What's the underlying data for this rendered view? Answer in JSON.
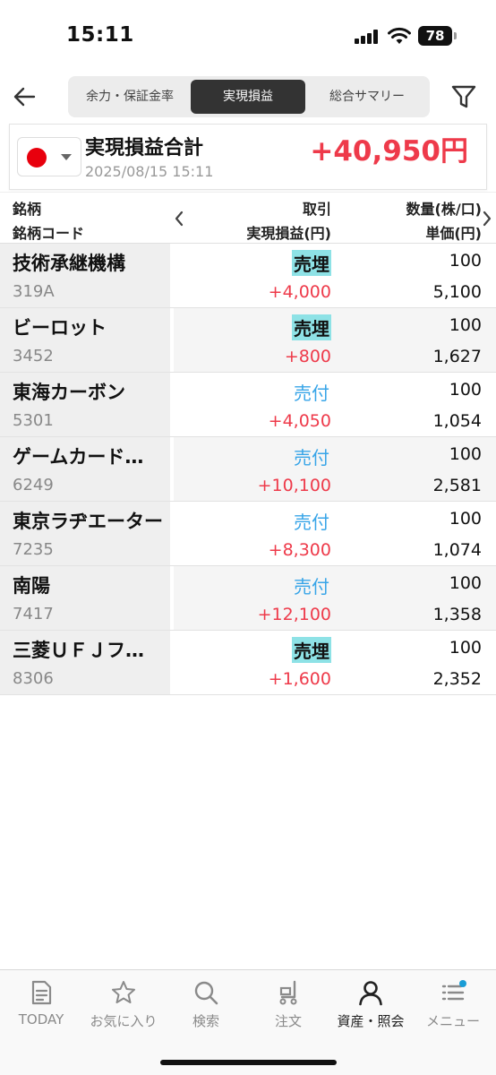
{
  "status": {
    "time": "15:11",
    "battery": "78"
  },
  "header": {
    "tabs": [
      {
        "label": "余力・保証金率",
        "active": false
      },
      {
        "label": "実現損益",
        "active": true
      },
      {
        "label": "総合サマリー",
        "active": false
      }
    ]
  },
  "summary": {
    "title": "実現損益合計",
    "date": "2025/08/15 15:11",
    "total": "+40,950円",
    "flag_color": "#e8000d"
  },
  "table": {
    "headers": {
      "name": "銘柄",
      "code": "銘柄コード",
      "trade": "取引",
      "pnl": "実現損益(円)",
      "qty": "数量(株/口)",
      "price": "単価(円)"
    },
    "rows": [
      {
        "name": "技術承継機構",
        "code": "319A",
        "trade": "売埋",
        "trade_kind": "sell-close",
        "pnl": "+4,000",
        "qty": "100",
        "price": "5,100"
      },
      {
        "name": "ビーロット",
        "code": "3452",
        "trade": "売埋",
        "trade_kind": "sell-close",
        "pnl": "+800",
        "qty": "100",
        "price": "1,627"
      },
      {
        "name": "東海カーボン",
        "code": "5301",
        "trade": "売付",
        "trade_kind": "sell-open",
        "pnl": "+4,050",
        "qty": "100",
        "price": "1,054"
      },
      {
        "name": "ゲームカード…",
        "code": "6249",
        "trade": "売付",
        "trade_kind": "sell-open",
        "pnl": "+10,100",
        "qty": "100",
        "price": "2,581"
      },
      {
        "name": "東京ラヂエーター",
        "code": "7235",
        "trade": "売付",
        "trade_kind": "sell-open",
        "pnl": "+8,300",
        "qty": "100",
        "price": "1,074"
      },
      {
        "name": "南陽",
        "code": "7417",
        "trade": "売付",
        "trade_kind": "sell-open",
        "pnl": "+12,100",
        "qty": "100",
        "price": "1,358"
      },
      {
        "name": "三菱ＵＦＪフ…",
        "code": "8306",
        "trade": "売埋",
        "trade_kind": "sell-close",
        "pnl": "+1,600",
        "qty": "100",
        "price": "2,352"
      }
    ]
  },
  "tabbar": {
    "items": [
      {
        "label": "TODAY",
        "icon": "document-icon",
        "active": false
      },
      {
        "label": "お気に入り",
        "icon": "star-icon",
        "active": false
      },
      {
        "label": "検索",
        "icon": "search-icon",
        "active": false
      },
      {
        "label": "注文",
        "icon": "cart-icon",
        "active": false
      },
      {
        "label": "資産・照会",
        "icon": "person-icon",
        "active": true
      },
      {
        "label": "メニュー",
        "icon": "menu-icon",
        "active": false
      }
    ]
  },
  "colors": {
    "profit": "#ee3a4a",
    "sell_open": "#38a5e8",
    "sell_close_bg": "#8ee2e6"
  }
}
